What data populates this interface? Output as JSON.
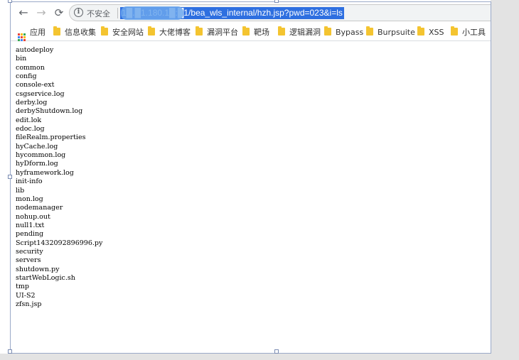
{
  "browser": {
    "nav": {
      "back_icon": "←",
      "forward_icon": "→",
      "reload_icon": "⟳"
    },
    "address_bar": {
      "info_icon": "i",
      "security_label": "不安全",
      "url": "1█.█1.180.1█:█1/bea_wls_internal/hzh.jsp?pwd=023&i=ls",
      "selected": true
    },
    "bookmarks": [
      {
        "label": "应用",
        "icon": "apps-icon"
      },
      {
        "label": "信息收集",
        "icon": "folder-icon"
      },
      {
        "label": "安全网站",
        "icon": "folder-icon"
      },
      {
        "label": "大佬博客",
        "icon": "folder-icon"
      },
      {
        "label": "漏洞平台",
        "icon": "folder-icon"
      },
      {
        "label": "靶场",
        "icon": "folder-icon"
      },
      {
        "label": "逻辑漏洞",
        "icon": "folder-icon"
      },
      {
        "label": "Bypass",
        "icon": "folder-icon"
      },
      {
        "label": "Burpsuite",
        "icon": "folder-icon"
      },
      {
        "label": "XSS",
        "icon": "folder-icon"
      },
      {
        "label": "小工具",
        "icon": "folder-icon"
      }
    ]
  },
  "listing": [
    "autodeploy",
    "bin",
    "common",
    "config",
    "console-ext",
    "csgservice.log",
    "derby.log",
    "derbyShutdown.log",
    "edit.lok",
    "edoc.log",
    "fileRealm.properties",
    "hyCache.log",
    "hycommon.log",
    "hyDform.log",
    "hyframework.log",
    "init-info",
    "lib",
    "mon.log",
    "nodemanager",
    "nohup.out",
    "null1.txt",
    "pending",
    "Script1432092896996.py",
    "security",
    "servers",
    "shutdown.py",
    "startWebLogic.sh",
    "tmp",
    "UI-S2",
    "zfsn.jsp"
  ],
  "colors": {
    "selection": "#2e6fe0",
    "folder": "#f4c430",
    "frame_border": "#9aa9c8"
  }
}
